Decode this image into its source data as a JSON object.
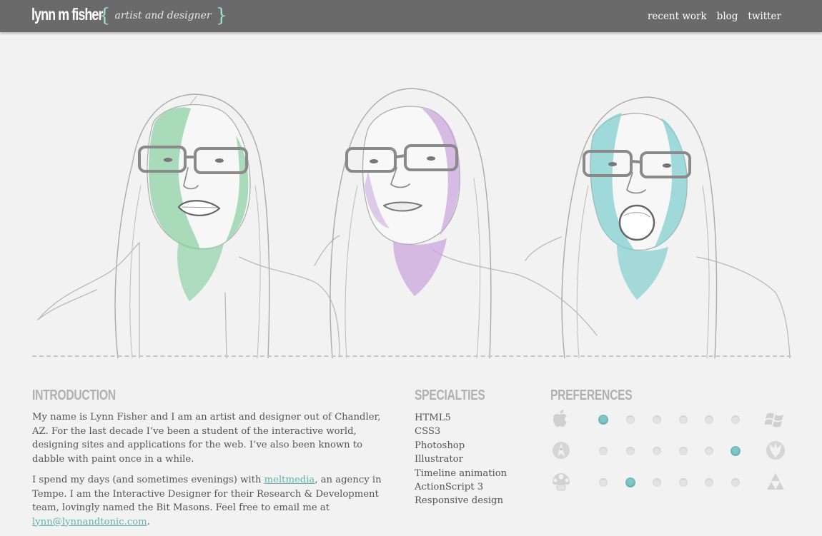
{
  "header": {
    "brand": "lynn m fisher",
    "tagline": "artist and designer",
    "brace_open": "{",
    "brace_close": "}",
    "nav": [
      "recent work",
      "blog",
      "twitter"
    ]
  },
  "hero": {
    "portraits": [
      {
        "accent": "#8fd1a6"
      },
      {
        "accent": "#c7a2db"
      },
      {
        "accent": "#82cfcf"
      }
    ]
  },
  "intro": {
    "heading": "INTRODUCTION",
    "p1": "My name is Lynn Fisher and I am an artist and designer out of Chandler, AZ. For the last decade I’ve been a student of the interactive world, designing sites and applications for the web. I’ve also been known to dabble with paint once in a while.",
    "p2_pre": "I spend my days (and sometimes evenings) with ",
    "p2_link": "meltmedia",
    "p2_mid": ", an agency in Tempe. I am the Interactive Designer for their Research & Development team, lovingly named the Bit Masons. Feel free to email me at ",
    "p2_email": "lynn@lynnandtonic.com",
    "p2_end": "."
  },
  "specialties": {
    "heading": "SPECIALTIES",
    "items": [
      "HTML5",
      "CSS3",
      "Photoshop",
      "Illustrator",
      "Timeline animation",
      "ActionScript 3",
      "Responsive design"
    ]
  },
  "preferences": {
    "heading": "PREFERENCES",
    "rows": [
      {
        "left_icon": "apple-icon",
        "right_icon": "windows-icon",
        "selected": 0
      },
      {
        "left_icon": "starfleet-icon",
        "right_icon": "rebel-alliance-icon",
        "selected": 5
      },
      {
        "left_icon": "mushroom-icon",
        "right_icon": "triforce-icon",
        "selected": 1
      }
    ],
    "accent": "#7cc8c6"
  }
}
